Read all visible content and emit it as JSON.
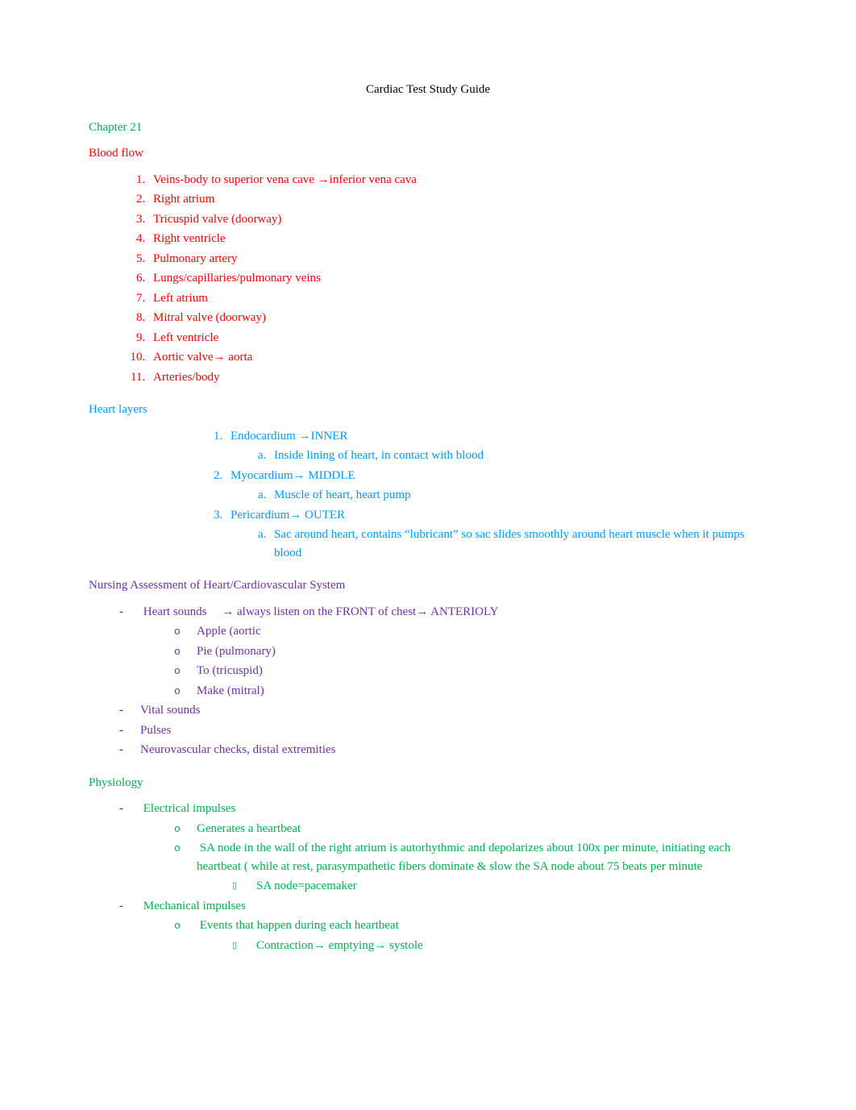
{
  "title": "Cardiac Test Study Guide",
  "bloodFlow": {
    "chapter": "Chapter 21",
    "heading": "Blood flow",
    "items": [
      "Veins-body to superior vena cave →inferior vena cava",
      "Right atrium",
      "Tricuspid valve (doorway)",
      "Right ventricle",
      "Pulmonary artery",
      "Lungs/capillaries/pulmonary veins",
      "Left atrium",
      "Mitral valve (doorway)",
      "Left ventricle",
      "Aortic valve→ aorta",
      "Arteries/body"
    ]
  },
  "heartLayers": {
    "heading": "Heart layers",
    "items": [
      {
        "label": "Endocardium →INNER",
        "sub": "Inside lining of heart, in contact with blood"
      },
      {
        "label": "Myocardium→ MIDDLE",
        "sub": "Muscle of heart, heart pump"
      },
      {
        "label": "Pericardium→ OUTER",
        "sub": "Sac around heart, contains “lubricant” so sac slides smoothly around heart muscle when it pumps blood"
      }
    ]
  },
  "assessment": {
    "heading": "Nursing Assessment of Heart/Cardiovascular System",
    "heartSoundsPre": "Heart sounds",
    "heartSoundsPost": "→ always listen on the FRONT of chest→ ANTERIOLY",
    "heartSoundsSub": [
      "Apple (aortic",
      "Pie (pulmonary)",
      "To (tricuspid)",
      "Make (mitral)"
    ],
    "extra": [
      "Vital sounds",
      "Pulses",
      "Neurovascular checks, distal extremities"
    ]
  },
  "physiology": {
    "heading": "Physiology",
    "electrical": {
      "label": "Electrical impulses",
      "sub1": "Generates a heartbeat",
      "sub2": "SA node in the wall of the right atrium is autorhythmic and depolarizes about 100x per minute, initiating each heartbeat ( while at rest, parasympathetic fibers dominate & slow the SA node about 75 beats per minute",
      "sub2a": "SA node=pacemaker"
    },
    "mechanical": {
      "label": "Mechanical impulses",
      "sub1": "Events that happen during each heartbeat",
      "sub1a": "Contraction→ emptying→ systole"
    }
  }
}
